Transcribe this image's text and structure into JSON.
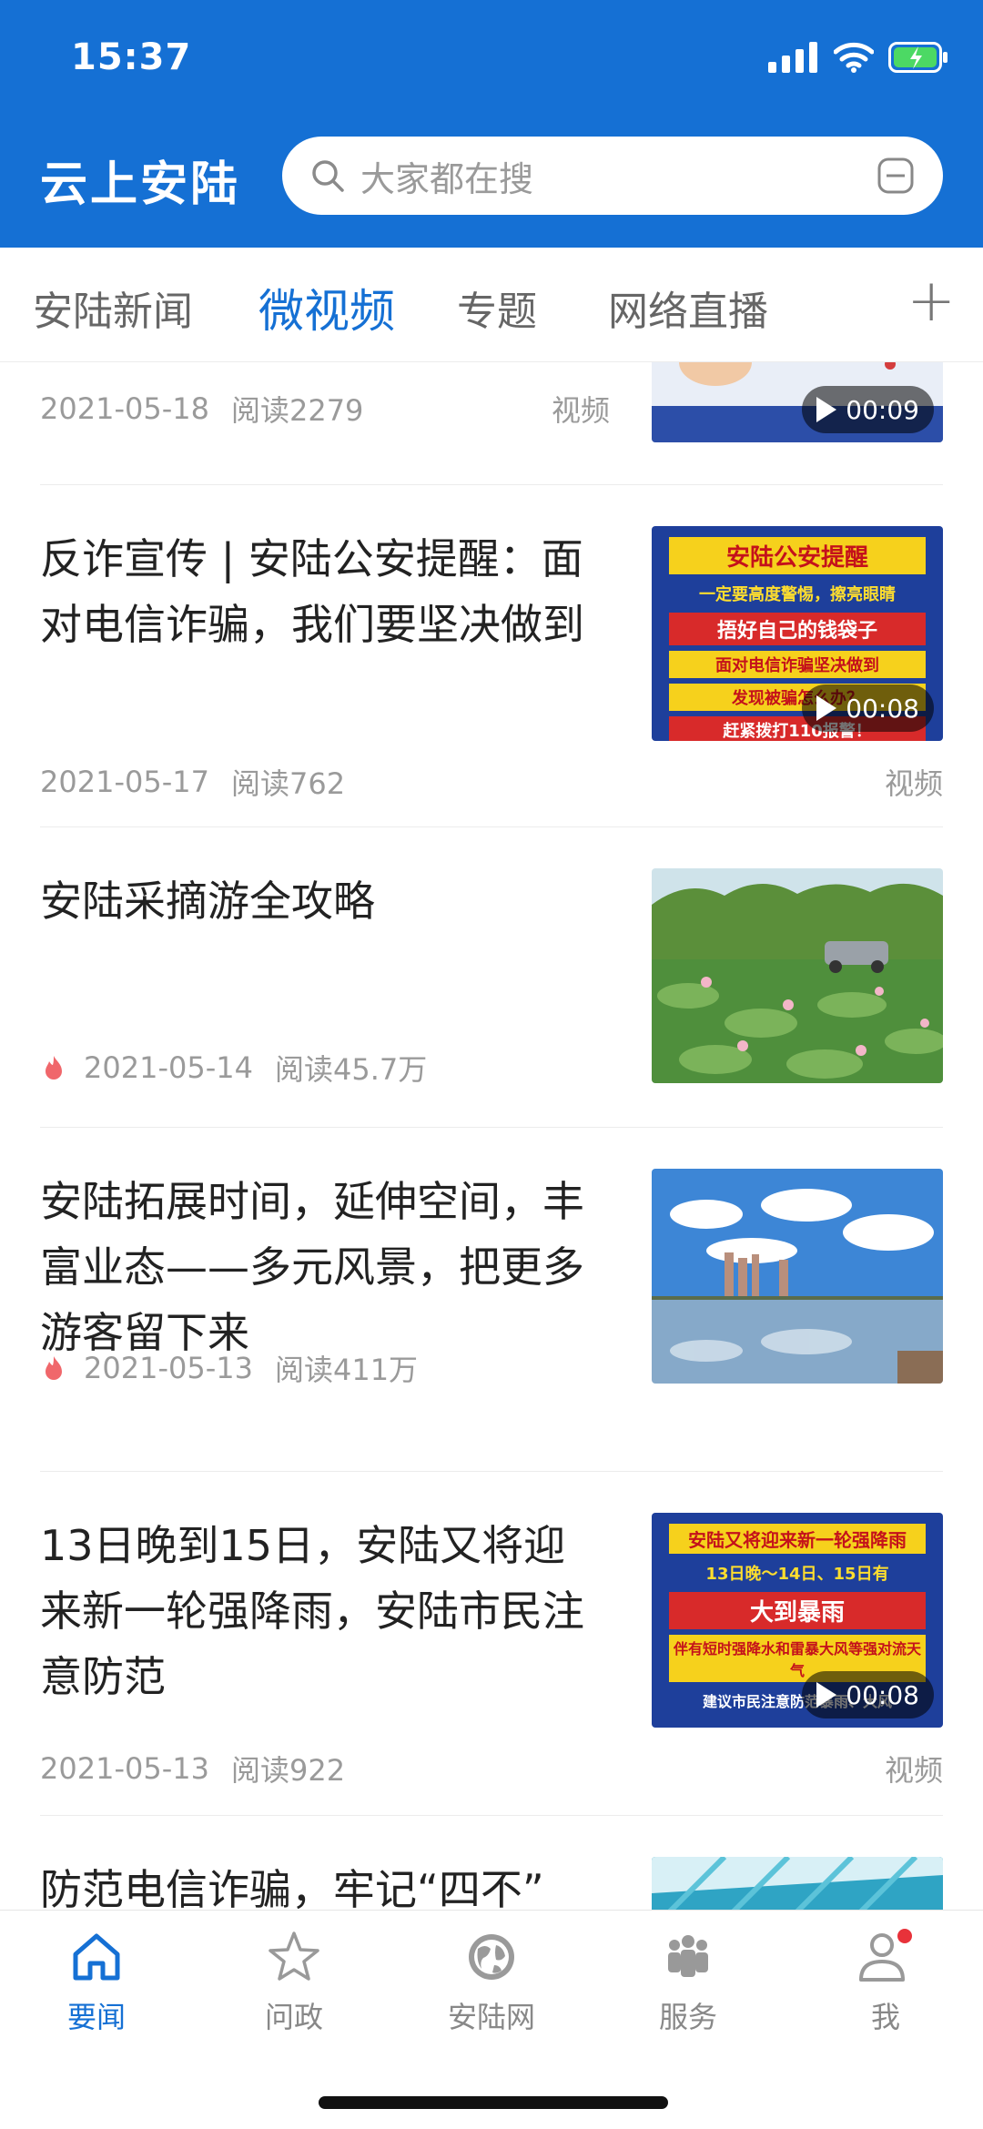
{
  "status_bar": {
    "time": "15:37"
  },
  "header": {
    "app_title": "云上安陆",
    "search_placeholder": "大家都在搜"
  },
  "tabs": [
    {
      "label": "安陆新闻",
      "active": false
    },
    {
      "label": "微视频",
      "active": true
    },
    {
      "label": "专题",
      "active": false
    },
    {
      "label": "网络直播",
      "active": false
    }
  ],
  "tab_more": "+",
  "feed": [
    {
      "title": "",
      "date": "2021-05-18",
      "reads": "阅读2279",
      "tag": "视频",
      "duration": "00:09",
      "hot": false
    },
    {
      "title": "反诈宣传 | 安陆公安提醒：面对电信诈骗，我们要坚决做到",
      "date": "2021-05-17",
      "reads": "阅读762",
      "tag": "视频",
      "duration": "00:08",
      "hot": false,
      "poster": {
        "headline": "安陆公安提醒",
        "line1": "一定要高度警惕，擦亮眼睛",
        "line2": "捂好自己的钱袋子",
        "line3": "面对电信诈骗坚决做到",
        "line4": "发现被骗怎么办？",
        "line5": "赶紧拨打110报警！"
      }
    },
    {
      "title": "安陆采摘游全攻略",
      "date": "2021-05-14",
      "reads": "阅读45.7万",
      "tag": "",
      "hot": true
    },
    {
      "title": "安陆拓展时间，延伸空间，丰富业态——多元风景，把更多游客留下来",
      "date": "2021-05-13",
      "reads": "阅读411万",
      "tag": "",
      "hot": true
    },
    {
      "title": "13日晚到15日，安陆又将迎来新一轮强降雨，安陆市民注意防范",
      "date": "2021-05-13",
      "reads": "阅读922",
      "tag": "视频",
      "duration": "00:08",
      "hot": false,
      "poster": {
        "headline": "安陆又将迎来新一轮强降雨",
        "line1": "13日晚～14日、15日有",
        "line2": "大到暴雨",
        "line3": "伴有短时强降水和雷暴大风等强对流天气",
        "line4": "建议市民注意防范暴雨、大风"
      }
    },
    {
      "title": "防范电信诈骗，牢记“四不”",
      "date": "",
      "reads": "",
      "tag": "",
      "hot": false
    }
  ],
  "bottom_nav": [
    {
      "label": "要闻",
      "icon": "home-icon",
      "active": true
    },
    {
      "label": "问政",
      "icon": "star-icon",
      "active": false
    },
    {
      "label": "安陆网",
      "icon": "globe-icon",
      "active": false
    },
    {
      "label": "服务",
      "icon": "people-icon",
      "active": false
    },
    {
      "label": "我",
      "icon": "user-icon",
      "active": false,
      "badge": true
    }
  ],
  "colors": {
    "brand": "#1570d4",
    "badge": "#e8323a",
    "hot": "#f0676b"
  }
}
